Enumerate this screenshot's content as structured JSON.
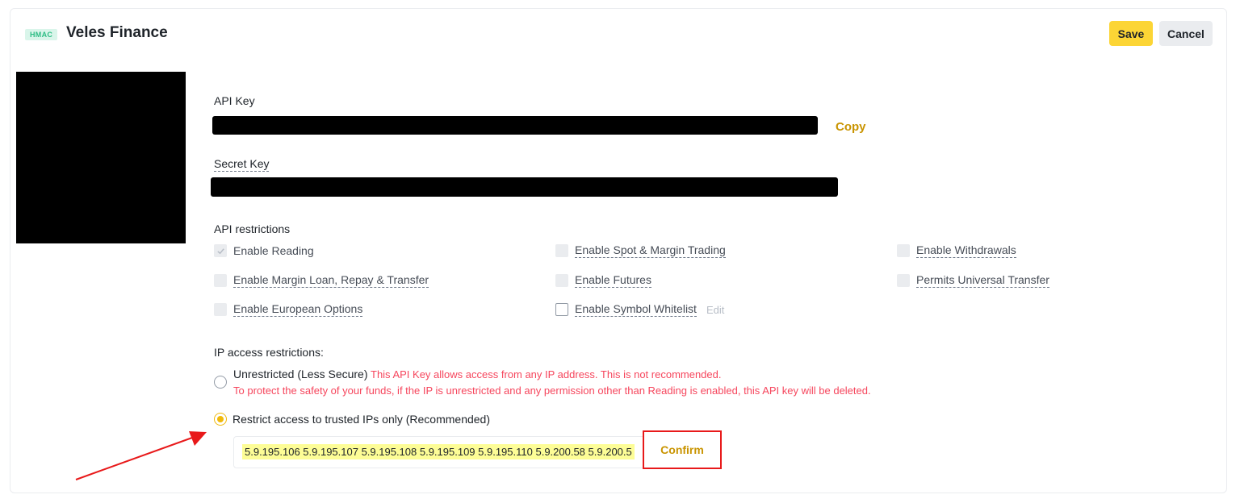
{
  "header": {
    "badge": "HMAC",
    "title": "Veles Finance",
    "save_label": "Save",
    "cancel_label": "Cancel"
  },
  "api_key": {
    "label": "API Key",
    "copy_label": "Copy"
  },
  "secret_key": {
    "label": "Secret Key"
  },
  "restrictions": {
    "title": "API restrictions",
    "items": [
      {
        "label": "Enable Reading",
        "checked": true
      },
      {
        "label": "Enable Spot & Margin Trading",
        "checked": false
      },
      {
        "label": "Enable Withdrawals",
        "checked": false
      },
      {
        "label": "Enable Margin Loan, Repay & Transfer",
        "checked": false
      },
      {
        "label": "Enable Futures",
        "checked": false
      },
      {
        "label": "Permits Universal Transfer",
        "checked": false
      },
      {
        "label": "Enable European Options",
        "checked": false
      },
      {
        "label": "Enable Symbol Whitelist",
        "checked": false
      }
    ],
    "edit_label": "Edit"
  },
  "ip": {
    "title": "IP access restrictions:",
    "unrestricted_label": "Unrestricted (Less Secure)",
    "warning_1": "This API Key allows access from any IP address. This is not recommended.",
    "warning_2": "To protect the safety of your funds, if the IP is unrestricted and any permission other than Reading is enabled, this API key will be deleted.",
    "restricted_label": "Restrict access to trusted IPs only (Recommended)",
    "selected": "restricted",
    "ip_list": "5.9.195.106 5.9.195.107 5.9.195.108 5.9.195.109 5.9.195.110 5.9.200.58 5.9.200.5",
    "confirm_label": "Confirm"
  },
  "colors": {
    "accent": "#fcd535",
    "link": "#c99400",
    "warning": "#f6465d",
    "annotation": "#e8191a"
  }
}
